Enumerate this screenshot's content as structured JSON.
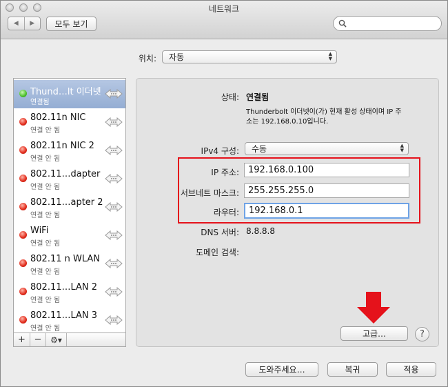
{
  "window": {
    "title": "네트워크"
  },
  "toolbar": {
    "show_all": "모두 보기",
    "search_placeholder": ""
  },
  "location": {
    "label": "위치:",
    "value": "자동"
  },
  "services": [
    {
      "name": "Thund…lt 이더넷",
      "status": "연결됨",
      "state": "green",
      "selected": true
    },
    {
      "name": "802.11n NIC",
      "status": "연결 안 됨",
      "state": "red",
      "selected": false
    },
    {
      "name": "802.11n NIC 2",
      "status": "연결 안 됨",
      "state": "red",
      "selected": false
    },
    {
      "name": "802.11…dapter",
      "status": "연결 안 됨",
      "state": "red",
      "selected": false
    },
    {
      "name": "802.11…apter 2",
      "status": "연결 안 됨",
      "state": "red",
      "selected": false
    },
    {
      "name": "WiFi",
      "status": "연결 안 됨",
      "state": "red",
      "selected": false
    },
    {
      "name": "802.11 n WLAN",
      "status": "연결 안 됨",
      "state": "red",
      "selected": false
    },
    {
      "name": "802.11…LAN 2",
      "status": "연결 안 됨",
      "state": "red",
      "selected": false
    },
    {
      "name": "802.11…LAN 3",
      "status": "연결 안 됨",
      "state": "red",
      "selected": false
    }
  ],
  "sidebar_bar": {
    "add": "+",
    "remove": "−",
    "gear": "⚙▾"
  },
  "detail": {
    "status_label": "상태:",
    "status_value": "연결됨",
    "status_desc_1": "Thunderbolt 이더넷이(가) 현재 활성 상태이며 IP 주",
    "status_desc_2": "소는 192.168.0.10입니다.",
    "ipv4_label": "IPv4 구성:",
    "ipv4_value": "수동",
    "ip_label": "IP 주소:",
    "ip_value": "192.168.0.100",
    "subnet_label": "서브네트 마스크:",
    "subnet_value": "255.255.255.0",
    "router_label": "라우터:",
    "router_value": "192.168.0.1",
    "dns_label": "DNS 서버:",
    "dns_value": "8.8.8.8",
    "domain_label": "도메인 검색:",
    "advanced": "고급…",
    "help": "?"
  },
  "footer": {
    "assist": "도와주세요…",
    "revert": "복귀",
    "apply": "적용"
  },
  "colors": {
    "highlight": "#e5121b",
    "arrow": "#e5121b",
    "selection": "#94add3"
  }
}
